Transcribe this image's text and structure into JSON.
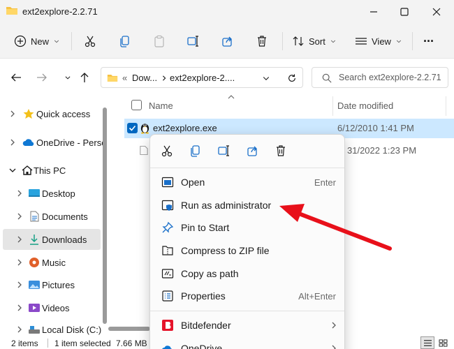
{
  "window": {
    "title": "ext2explore-2.2.71"
  },
  "commandbar": {
    "new_label": "New",
    "sort_label": "Sort",
    "view_label": "View",
    "more_label": "···"
  },
  "address": {
    "overflow": "«",
    "crumb1": "Dow...",
    "crumb2": "ext2explore-2....",
    "search_placeholder": "Search ext2explore-2.2.71"
  },
  "nav": {
    "items": [
      {
        "label": "Quick access"
      },
      {
        "label": "OneDrive - Perso"
      },
      {
        "label": "This PC"
      },
      {
        "label": "Desktop"
      },
      {
        "label": "Documents"
      },
      {
        "label": "Downloads"
      },
      {
        "label": "Music"
      },
      {
        "label": "Pictures"
      },
      {
        "label": "Videos"
      },
      {
        "label": "Local Disk (C:)"
      }
    ]
  },
  "filelist": {
    "col_name": "Name",
    "col_date": "Date modified",
    "rows": [
      {
        "name": "ext2explore.exe",
        "date": "6/12/2010 1:41 PM"
      },
      {
        "name": "",
        "date": "31/2022 1:23 PM"
      }
    ]
  },
  "status": {
    "items_count": "2 items",
    "selected": "1 item selected",
    "size": "7.66 MB"
  },
  "context_menu": {
    "items": [
      {
        "label": "Open",
        "shortcut": "Enter",
        "icon": "open-window-icon"
      },
      {
        "label": "Run as administrator",
        "shortcut": "",
        "icon": "shield-icon"
      },
      {
        "label": "Pin to Start",
        "shortcut": "",
        "icon": "pin-icon"
      },
      {
        "label": "Compress to ZIP file",
        "shortcut": "",
        "icon": "zip-icon"
      },
      {
        "label": "Copy as path",
        "shortcut": "",
        "icon": "path-icon"
      },
      {
        "label": "Properties",
        "shortcut": "Alt+Enter",
        "icon": "properties-icon"
      },
      {
        "label": "Bitdefender",
        "shortcut": "",
        "icon": "bitdefender-icon"
      },
      {
        "label": "OneDrive",
        "shortcut": "",
        "icon": "onedrive-icon"
      }
    ]
  },
  "colors": {
    "accent": "#0067c0",
    "selection": "#cce8ff",
    "annotation": "#e8101a",
    "bitdefender": "#e5132a"
  }
}
